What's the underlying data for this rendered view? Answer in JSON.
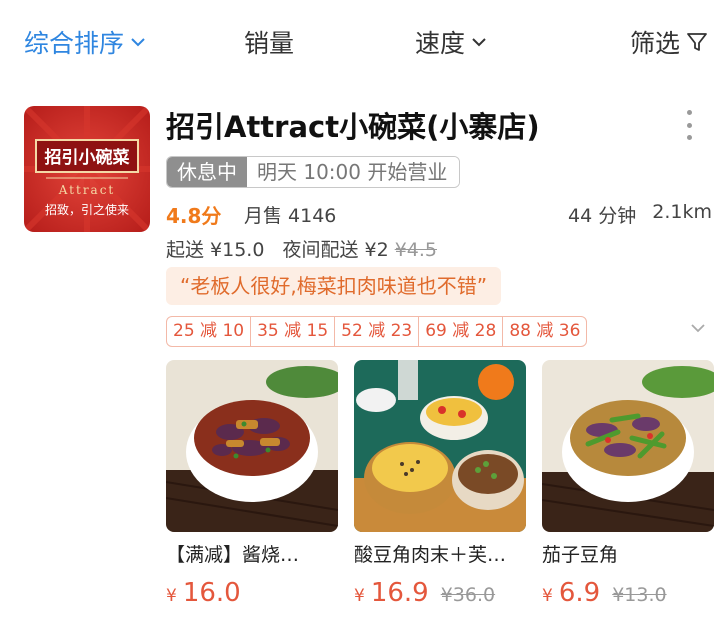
{
  "sort_bar": {
    "items": [
      {
        "label": "综合排序",
        "active": true,
        "icon": "chevron-down-icon"
      },
      {
        "label": "销量",
        "active": false
      },
      {
        "label": "速度",
        "active": false,
        "icon": "chevron-down-icon"
      },
      {
        "label": "筛选",
        "active": false,
        "icon": "filter-icon"
      }
    ]
  },
  "store": {
    "logo": {
      "title": "招引小碗菜",
      "subtitle": "Attract",
      "slogan": "招致，引之使来"
    },
    "name": "招引Attract小碗菜(小寨店)",
    "status_badge": "休息中",
    "open_info": "明天 10:00 开始营业",
    "rating": "4.8分",
    "monthly_sales": "月售 4146",
    "delivery_time": "44 分钟",
    "distance": "2.1km",
    "min_order": "起送 ¥15.0",
    "night_delivery": "夜间配送 ¥2",
    "night_delivery_original": "¥4.5",
    "review": "“老板人很好,梅菜扣肉味道也不错”",
    "coupons": [
      "25 减 10",
      "35 减 15",
      "52 减 23",
      "69 减 28",
      "88 减 36"
    ]
  },
  "dishes": [
    {
      "name": "【满减】酱烧…",
      "currency": "¥",
      "price": "16.0",
      "original_price": ""
    },
    {
      "name": "酸豆角肉末＋芙…",
      "currency": "¥",
      "price": "16.9",
      "original_price": "¥36.0"
    },
    {
      "name": "茄子豆角",
      "currency": "¥",
      "price": "6.9",
      "original_price": "¥13.0"
    }
  ],
  "colors": {
    "accent": "#2f86e0",
    "price": "#e4573c",
    "rating": "#f07a1b"
  }
}
